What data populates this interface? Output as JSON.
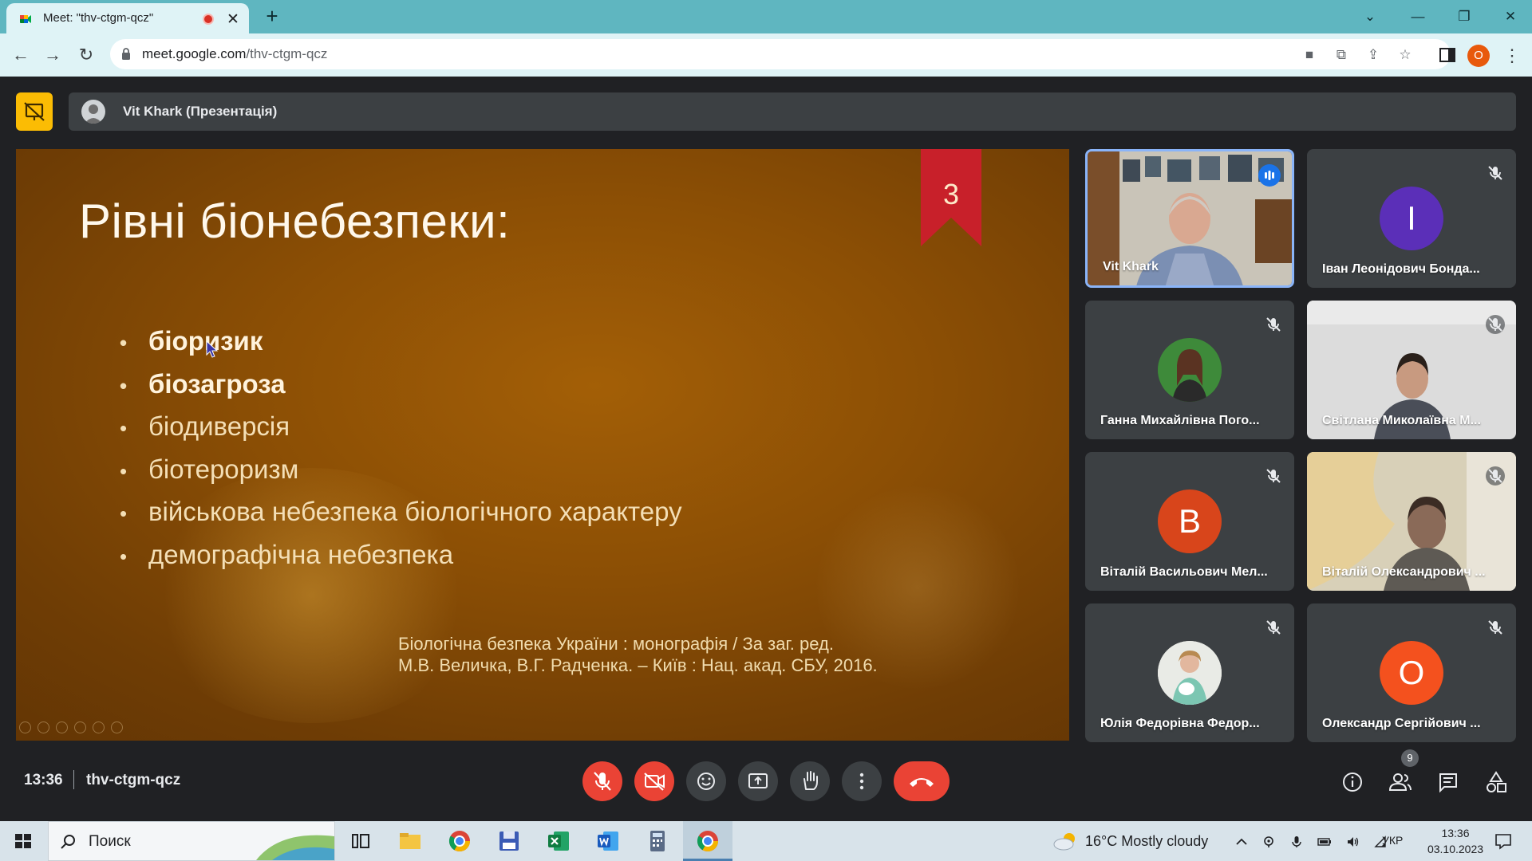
{
  "browser": {
    "tab_title": "Meet: \"thv-ctgm-qcz\"",
    "url_host": "meet.google.com",
    "url_path": "/thv-ctgm-qcz",
    "profile_initial": "O"
  },
  "presentation": {
    "presenter_label": "Vit Khark (Презентація)"
  },
  "slide": {
    "title": "Рівні біонебезпеки:",
    "ribbon_number": "3",
    "bullets": [
      "біоризик",
      "біозагроза",
      "біодиверсія",
      "біотероризм",
      "військова небезпека біологічного характеру",
      "демографічна небезпека"
    ],
    "source_line1": "Біологічна безпека України : монографія / За заг. ред.",
    "source_line2": "М.В. Величка, В.Г. Радченка. – Київ : Нац. акад. СБУ, 2016."
  },
  "participants": [
    {
      "name": "Vit Khark",
      "type": "video",
      "speaking": true
    },
    {
      "name": "Іван Леонідович Бонда...",
      "initial": "І",
      "color": "#5b2fb8",
      "muted": true
    },
    {
      "name": "Ганна Михайлівна Пого...",
      "type": "photo",
      "muted": true
    },
    {
      "name": "Світлана Миколаївна М...",
      "type": "video",
      "muted": true
    },
    {
      "name": "Віталій Васильович Мел...",
      "initial": "В",
      "color": "#d8451b",
      "muted": true
    },
    {
      "name": "Віталій Олександрович ...",
      "type": "video",
      "muted": true
    },
    {
      "name": "Юлія Федорівна Федор...",
      "type": "photo",
      "muted": true
    },
    {
      "name": "Олександр Сергійович ...",
      "initial": "О",
      "color": "#f4511e",
      "muted": true
    }
  ],
  "meeting": {
    "time": "13:36",
    "code": "thv-ctgm-qcz",
    "people_count": "9"
  },
  "taskbar": {
    "search_placeholder": "Поиск",
    "weather": "16°C  Mostly cloudy",
    "language": "УКР",
    "time": "13:36",
    "date": "03.10.2023"
  }
}
